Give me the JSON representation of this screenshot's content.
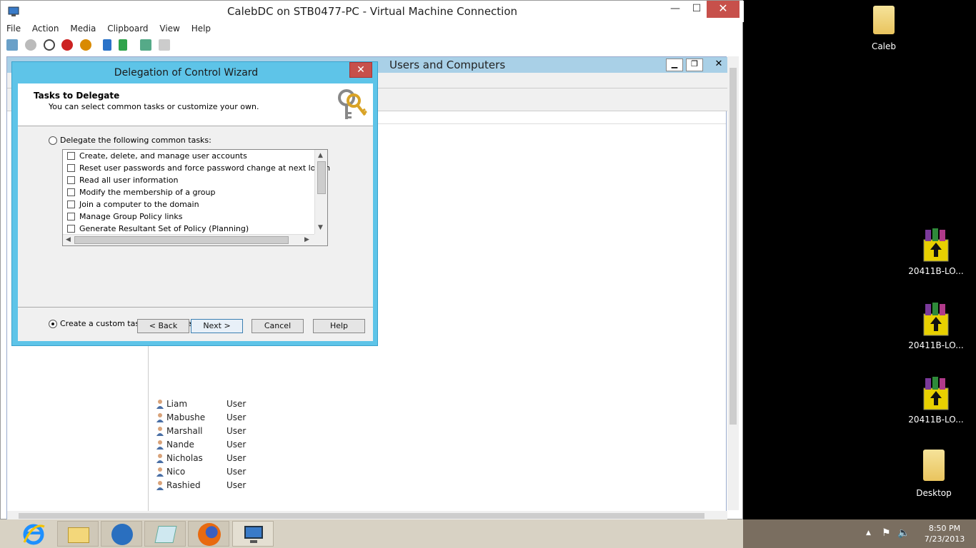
{
  "vm": {
    "title": "CalebDC on STB0477-PC - Virtual Machine Connection",
    "menu": [
      "File",
      "Action",
      "Media",
      "Clipboard",
      "View",
      "Help"
    ],
    "controls": {
      "minimize": "—",
      "maximize": "☐",
      "close": "✕"
    }
  },
  "aduc": {
    "title_visible": "Users and Computers",
    "controls": {
      "minimize": "▁",
      "restore": "❐",
      "close": "✕"
    },
    "users": [
      {
        "name": "Liam",
        "type": "User"
      },
      {
        "name": "Mabushe",
        "type": "User"
      },
      {
        "name": "Marshall",
        "type": "User"
      },
      {
        "name": "Nande",
        "type": "User"
      },
      {
        "name": "Nicholas",
        "type": "User"
      },
      {
        "name": "Nico",
        "type": "User"
      },
      {
        "name": "Rashied",
        "type": "User"
      }
    ]
  },
  "wizard": {
    "title": "Delegation of Control Wizard",
    "close": "✕",
    "heading": "Tasks to Delegate",
    "subheading": "You can select common tasks or customize your own.",
    "option_common": "Delegate the following common tasks:",
    "option_custom": "Create a custom task to delegate",
    "selected_option": "custom",
    "tasks": [
      "Create, delete, and manage user accounts",
      "Reset user passwords and force password change at next logon",
      "Read all user information",
      "Modify the membership of a group",
      "Join a computer to the domain",
      "Manage Group Policy links",
      "Generate Resultant Set of Policy (Planning)"
    ],
    "buttons": {
      "back": "< Back",
      "next": "Next >",
      "cancel": "Cancel",
      "help": "Help"
    }
  },
  "desktop": {
    "icons": [
      {
        "label": "Caleb",
        "kind": "folder-icon"
      },
      {
        "label": "20411B-LO...",
        "kind": "winrar-icon"
      },
      {
        "label": "20411B-LO...",
        "kind": "winrar-icon"
      },
      {
        "label": "20411B-LO...",
        "kind": "winrar-icon"
      },
      {
        "label": "Desktop",
        "kind": "folder-icon"
      }
    ]
  },
  "taskbar": {
    "time": "8:50 PM",
    "date": "7/23/2013",
    "apps": [
      "internet-explorer-icon",
      "file-explorer-icon",
      "server-manager-icon",
      "notepad-icon",
      "firefox-icon",
      "vm-connection-icon"
    ]
  },
  "colors": {
    "wizard_frame": "#5ec4e8",
    "close_red": "#c7504b",
    "taskbar": "#7a6e60"
  }
}
